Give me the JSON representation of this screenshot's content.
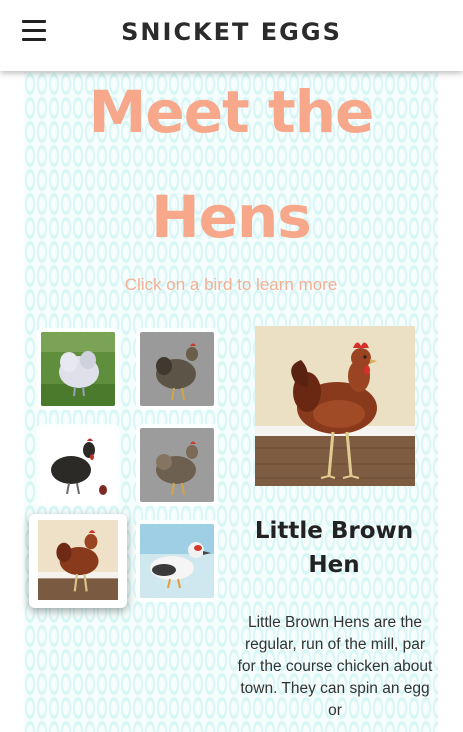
{
  "nav": {
    "brand": "SNICKET EGGS",
    "menu_icon": "hamburger-menu-icon"
  },
  "hero": {
    "title_line1": "Meet the",
    "title_line2": "Hens",
    "subtitle": "Click on a bird to learn more"
  },
  "gallery": {
    "thumbnails": [
      {
        "icon": "white-silkie-hen-photo"
      },
      {
        "icon": "grey-speckled-hen-photo"
      },
      {
        "icon": "black-hen-with-egg-photo"
      },
      {
        "icon": "barred-hen-photo"
      },
      {
        "icon": "little-brown-hen-photo",
        "selected": true
      },
      {
        "icon": "white-duck-photo"
      }
    ]
  },
  "detail": {
    "name": "Little Brown Hen",
    "description": "Little Brown Hens are the regular, run of the mill, par for the course chicken about town. They can spin an egg or"
  },
  "colors": {
    "accent_salmon": "#f7a88a",
    "pattern_teal": "#d4f5f6",
    "text_dark": "#222222"
  }
}
